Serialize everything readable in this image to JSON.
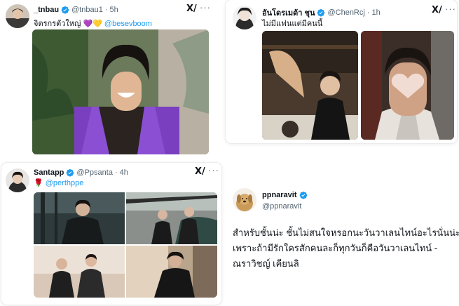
{
  "tweets": [
    {
      "name": "_tnbau",
      "handle": "@tnbau1",
      "time": "5h",
      "text": "จิตรกรตัวใหญ่",
      "emoji": "💜💛",
      "mention": "@besevboom"
    },
    {
      "name": "อันโดรเมด้า ชุน",
      "handle": "@ChenRcj",
      "time": "1h",
      "text": "ไม่มีแฟนแต่มีคนนี้"
    },
    {
      "name": "Santapp",
      "handle": "@Ppsanta",
      "time": "4h",
      "emoji": "🌹",
      "mention": "@perthppe"
    },
    {
      "name": "ppnaravit",
      "handle": "@ppnaravit",
      "text_line1": "สำหรับชั้นน่ะ ชั้นไม่สนใจหรอกนะวันวาเลนไทน์อะไรนั่นน่ะ",
      "text_line2": "เพราะถ้ามีรักใครสักคนละก็ทุกวันก็คือวันวาเลนไทน์ -",
      "text_line3": "ณราวิชญ์ เคียนลิ"
    }
  ],
  "ui": {
    "dot": "·",
    "grok_glyph": "X/",
    "more_glyph": "···"
  },
  "colors": {
    "verified": "#1d9bf0",
    "link": "#1d9bf0",
    "text": "#0f1419",
    "muted": "#536471"
  }
}
